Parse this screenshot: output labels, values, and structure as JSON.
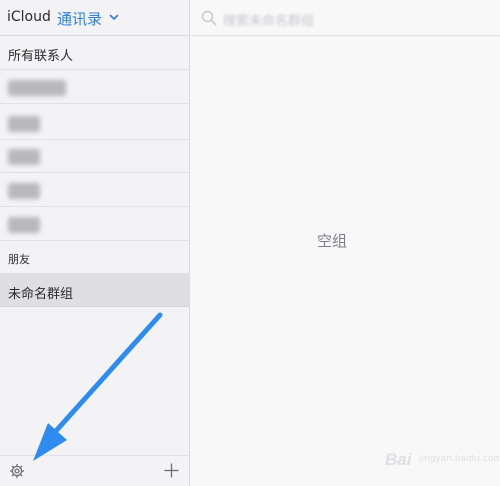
{
  "header": {
    "brand": "iCloud",
    "title": "通讯录"
  },
  "sidebar": {
    "all_contacts": "所有联系人",
    "groups": [
      "",
      "",
      "",
      "",
      ""
    ],
    "friends": "朋友",
    "selected_group": "未命名群组"
  },
  "search": {
    "placeholder": "搜索未命名群组"
  },
  "main": {
    "empty_message": "空组"
  },
  "watermark": {
    "text": "Bai",
    "sub": "jingyan.baidu.com"
  },
  "icons": {
    "title_dropdown": "chevron-down-icon",
    "settings": "gear-icon",
    "add": "plus-icon",
    "search": "search-icon",
    "annotation": "arrow-annotation"
  },
  "colors": {
    "accent": "#2f7fe0",
    "arrow": "#2e8bef"
  }
}
